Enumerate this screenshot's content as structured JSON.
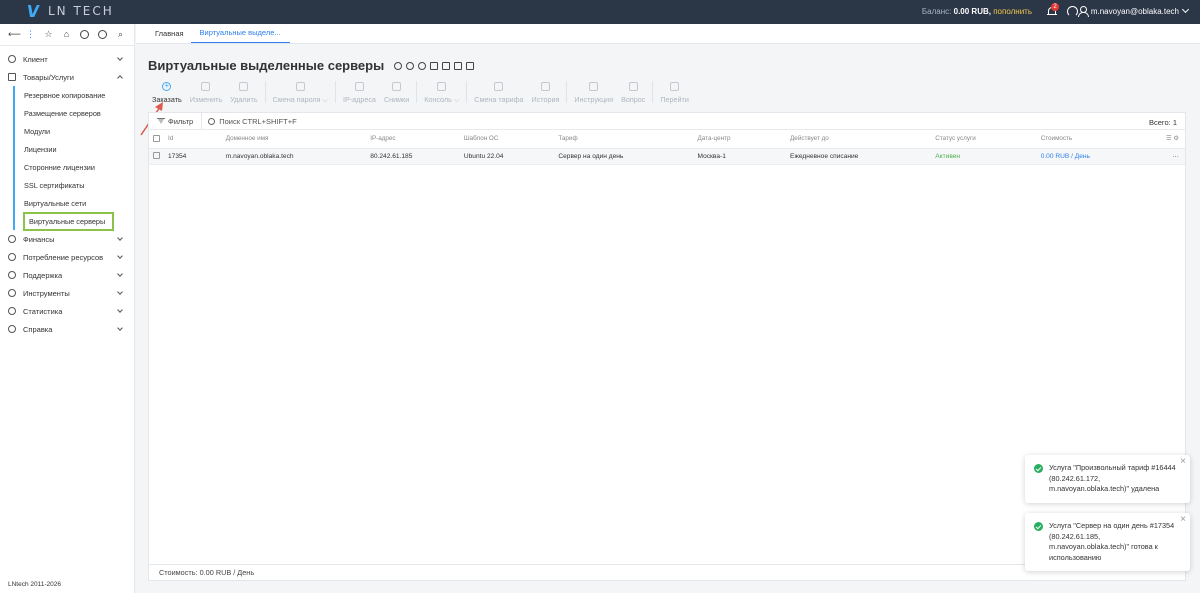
{
  "header": {
    "logo_text": "LN TECH",
    "balance_label": "Баланс:",
    "balance_value": "0.00 RUB,",
    "pay_label": "пополнить",
    "notif_count": "2",
    "user_email": "m.navoyan@oblaka.tech"
  },
  "tabs": [
    {
      "label": "Главная"
    },
    {
      "label": "Виртуальные выделе..."
    }
  ],
  "sidebar": {
    "items": [
      {
        "label": "Клиент"
      },
      {
        "label": "Товары/Услуги"
      },
      {
        "label": "Финансы"
      },
      {
        "label": "Потребление ресурсов"
      },
      {
        "label": "Поддержка"
      },
      {
        "label": "Инструменты"
      },
      {
        "label": "Статистика"
      },
      {
        "label": "Справка"
      }
    ],
    "subitems": [
      {
        "label": "Резервное копирование"
      },
      {
        "label": "Размещение серверов"
      },
      {
        "label": "Модули"
      },
      {
        "label": "Лицензии"
      },
      {
        "label": "Сторонние лицензии"
      },
      {
        "label": "SSL сертификаты"
      },
      {
        "label": "Виртуальные сети"
      },
      {
        "label": "Виртуальные серверы"
      }
    ],
    "copyright": "LNtech 2011-2026"
  },
  "page": {
    "title": "Виртуальные выделенные серверы"
  },
  "toolbar": {
    "order": "Заказать",
    "edit": "Изменить",
    "delete": "Удалить",
    "change_password": "Смена пароля",
    "ip": "IP-адреса",
    "snapshots": "Снимки",
    "console": "Консоль",
    "change_tariff": "Смена тарифа",
    "history": "История",
    "instruction": "Инструкция",
    "question": "Вопрос",
    "go": "Перейти"
  },
  "grid": {
    "filter_label": "Фильтр",
    "search_placeholder": "Поиск CTRL+SHIFT+F",
    "total": "Всего: 1",
    "columns": [
      "Id",
      "Доменное имя",
      "IP-адрес",
      "Шаблон ОС",
      "Тариф",
      "Дата-центр",
      "Действует до",
      "Статус услуги",
      "Стоимость"
    ],
    "rows": [
      {
        "id": "17354",
        "domain": "m.navoyan.oblaka.tech",
        "ip": "80.242.61.185",
        "os": "Ubuntu 22.04",
        "tariff": "Сервер на один день",
        "dc": "Москва-1",
        "valid": "Ежедневное списание",
        "status": "Активен",
        "cost": "0.00 RUB / День"
      }
    ],
    "footer": "Стоимость: 0.00 RUB / День"
  },
  "toasts": [
    {
      "text": "Услуга \"Произвольный тариф #16444 (80.242.61.172, m.navoyan.oblaka.tech)\" удалена"
    },
    {
      "text": "Услуга \"Сервер на один день #17354 (80.242.61.185, m.navoyan.oblaka.tech)\" готова к использованию"
    }
  ],
  "colors": {
    "topbar": "#2b3647",
    "accent": "#2f80ed",
    "highlight_box": "#8bc34a",
    "arrow": "#e05a4f",
    "success": "#27ae60"
  }
}
